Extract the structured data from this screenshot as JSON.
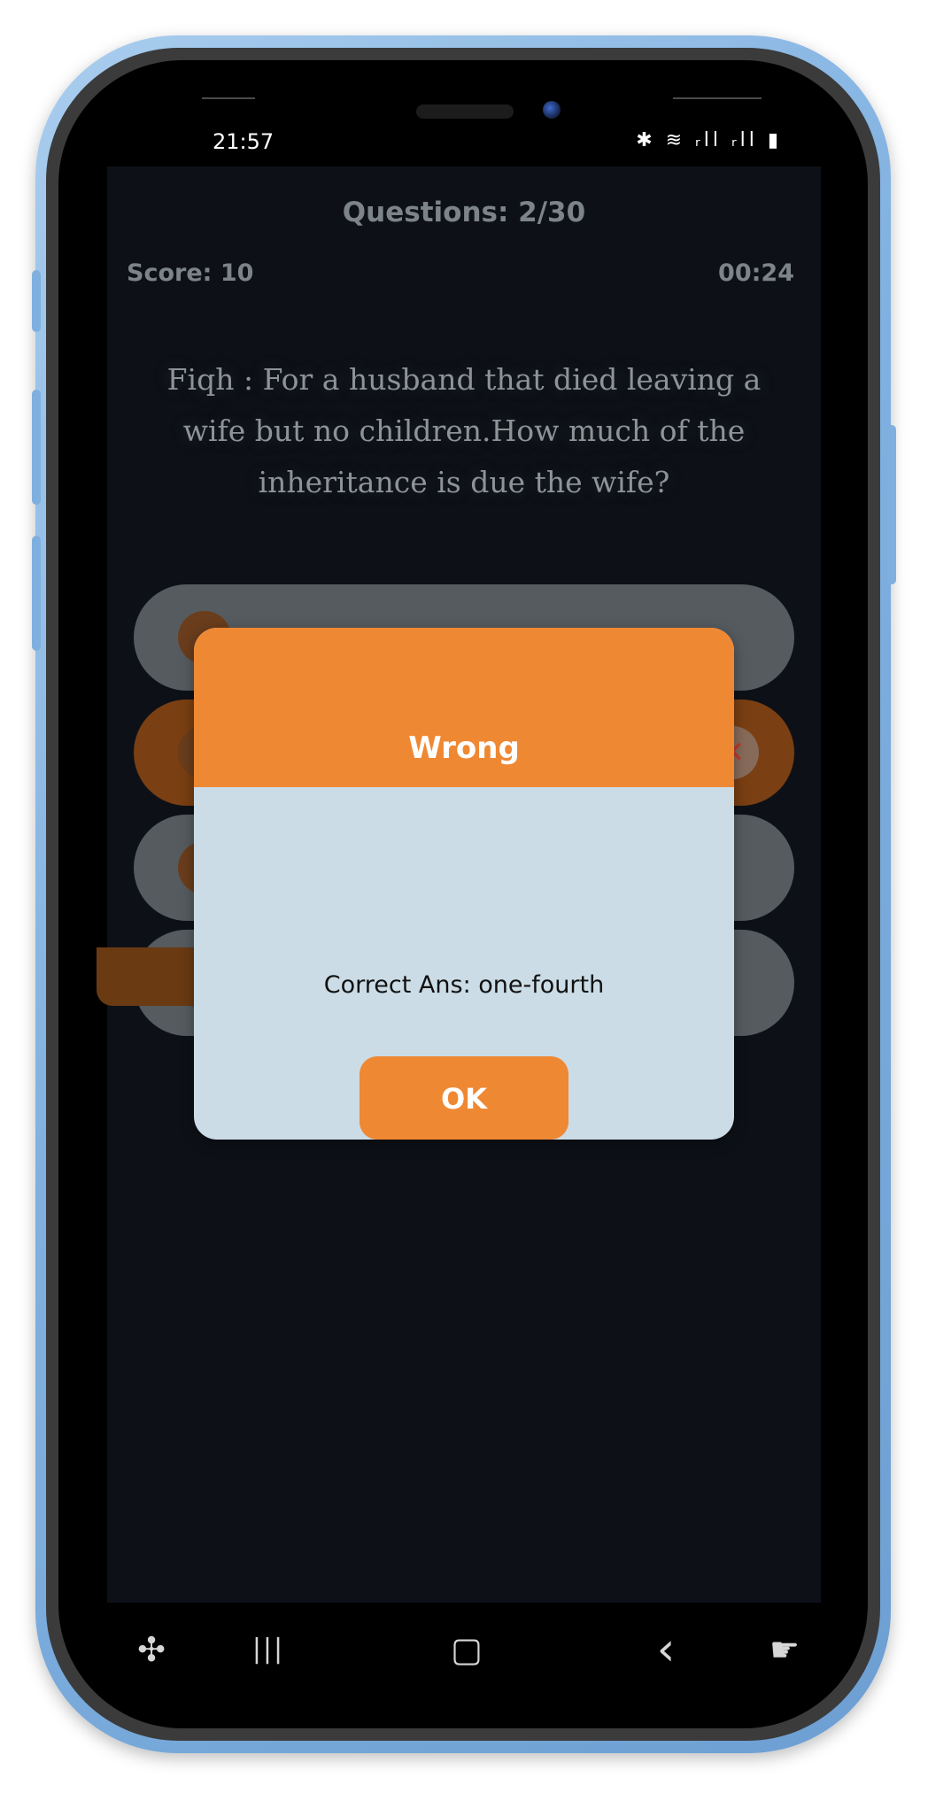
{
  "status_bar": {
    "time": "21:57",
    "icons": "✱ ≋ ᵣll ᵣll ▮"
  },
  "quiz": {
    "question_counter": "Questions: 2/30",
    "score": "Score: 10",
    "timer": "00:24",
    "question_text": "Fiqh : For a husband that died leaving a wife but no children.How much of the inheritance is due the wife?"
  },
  "dialog": {
    "title": "Wrong",
    "message": "Correct Ans: one-fourth",
    "ok_label": "OK"
  },
  "nav": {
    "game_icon": "✣",
    "recents_icon": "|||",
    "home_icon": "▢",
    "back_icon": "‹",
    "assist_icon": "☛"
  },
  "colors": {
    "accent": "#ef8833",
    "app_background": "#0d1117",
    "dialog_background": "#cbdce6"
  }
}
